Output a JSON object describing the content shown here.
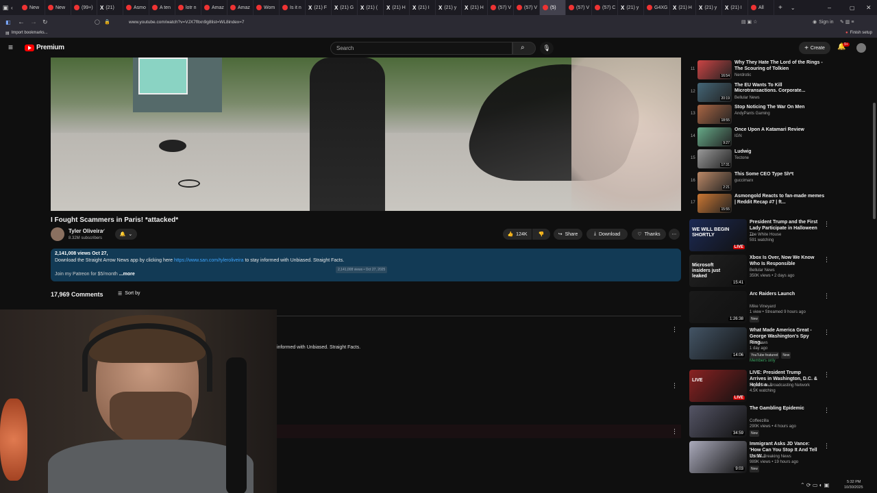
{
  "browser": {
    "tabs": [
      {
        "label": "New"
      },
      {
        "label": "New"
      },
      {
        "label": "(99+)"
      },
      {
        "label": "(21)"
      },
      {
        "label": "Asmo"
      },
      {
        "label": "A ten"
      },
      {
        "label": "lotr n"
      },
      {
        "label": "Amaz"
      },
      {
        "label": "Amaz"
      },
      {
        "label": "Wom"
      },
      {
        "label": "Is it n"
      },
      {
        "label": "(21) F"
      },
      {
        "label": "(21) G"
      },
      {
        "label": "(21) ("
      },
      {
        "label": "(21) H"
      },
      {
        "label": "(21) I"
      },
      {
        "label": "(21) y"
      },
      {
        "label": "(21) H"
      },
      {
        "label": "(57) V"
      },
      {
        "label": "(57) V"
      },
      {
        "label": "(5)"
      },
      {
        "label": "(57) V"
      },
      {
        "label": "(57) C"
      },
      {
        "label": "(21) y"
      },
      {
        "label": "G4XG"
      },
      {
        "label": "(21) H"
      },
      {
        "label": "(21) y"
      },
      {
        "label": "(21) I"
      },
      {
        "label": "All"
      }
    ],
    "url": "www.youtube.com/watch?v=VJX7fltxn9g8list=WL8index=7",
    "bookmark": "Import bookmarks...",
    "sign_in": "Sign in",
    "finish_setup": "Finish setup"
  },
  "header": {
    "logo": "Premium",
    "search_placeholder": "Search",
    "create_label": "Create",
    "notif_count": "9+"
  },
  "video": {
    "title": "I Fought Scammers in Paris! *attacked*",
    "channel": "Tyler Oliveira",
    "subscribers": "8.32M subscribers",
    "likes": "124K",
    "share": "Share",
    "download": "Download",
    "thanks": "Thanks",
    "views_date": "2,141,008 views  Oct 27,",
    "description_line": "Download the Straight Arrow News app by clicking here",
    "description_link": "https://www.san.com/tyleroliveira",
    "description_after": "to stay informed with Unbiased. Straight Facts.",
    "tooltip": "2,141,008 views • Oct 27, 2025",
    "patreon": "Join my Patreon for $5/month",
    "more": "...more",
    "comments_count": "17,969 Comments",
    "sort_by": "Sort by",
    "comment_fragment": "informed with Unbiased. Straight Facts."
  },
  "playlist": [
    {
      "num": "11",
      "title": "Why They Hate The Lord of the Rings - The Scouring of Tolkien",
      "channel": "Nerdrotic",
      "duration": "16:54"
    },
    {
      "num": "12",
      "title": "The EU Wants To Kill Microtransactions. Corporate...",
      "channel": "Bellular News",
      "duration": "20:19"
    },
    {
      "num": "13",
      "title": "Stop Noticing The War On Men",
      "channel": "AndyPants Gaming",
      "duration": "18:55"
    },
    {
      "num": "14",
      "title": "Once Upon A Katamari Review",
      "channel": "IGN",
      "duration": "9:27"
    },
    {
      "num": "15",
      "title": "Ludwig",
      "channel": "Tectone",
      "duration": "17:31"
    },
    {
      "num": "16",
      "title": "This Some CEO Type Sh*t",
      "channel": "guccimarx",
      "duration": "2:21"
    },
    {
      "num": "17",
      "title": "Asmongold Reacts to fan-made memes | Reddit Recap #7 | ft...",
      "channel": "",
      "duration": "15:55"
    }
  ],
  "recommended": [
    {
      "title": "President Trump and the First Lady Participate in Halloween ...",
      "channel": "The White House",
      "meta": "591 watching",
      "duration": "LIVE",
      "thumb_text": "WE WILL BEGIN SHORTLY"
    },
    {
      "title": "Xbox Is Over, Now We Know Who Is Responsible",
      "channel": "Bellular News",
      "meta": "350K views • 2 days ago",
      "duration": "15:41",
      "thumb_text": "Microsoft insiders just leaked"
    },
    {
      "title": "Arc Raiders Launch",
      "channel": "Mike Vineyard",
      "meta": "1 view • Streamed 9 hours ago",
      "duration": "1:26:38",
      "badge": "New"
    },
    {
      "title": "What Made America Great - George Washington's Spy Ring...",
      "channel": "Fox News",
      "meta": "1 day ago",
      "duration": "14:06",
      "badge": "YouTube featured",
      "badge2": "New",
      "extra": "Members only"
    },
    {
      "title": "LIVE: President Trump Arrives in Washington, D.C. & Holds a ...",
      "channel": "Right Side Broadcasting Network",
      "meta": "4.5K watching",
      "duration": "LIVE",
      "thumb_text": "LIVE"
    },
    {
      "title": "The Gambling Epidemic",
      "channel": "Coffeezilla",
      "meta": "290K views • 4 hours ago",
      "duration": "34:59",
      "badge": "New"
    },
    {
      "title": "Immigrant Asks JD Vance: 'How Can You Stop It And Tell Us W...",
      "channel": "Forbes Breaking News",
      "meta": "989K views • 19 hours ago",
      "duration": "9:03",
      "badge": "New"
    }
  ],
  "taskbar": {
    "time": "5:32 PM",
    "date": "10/30/2025"
  }
}
